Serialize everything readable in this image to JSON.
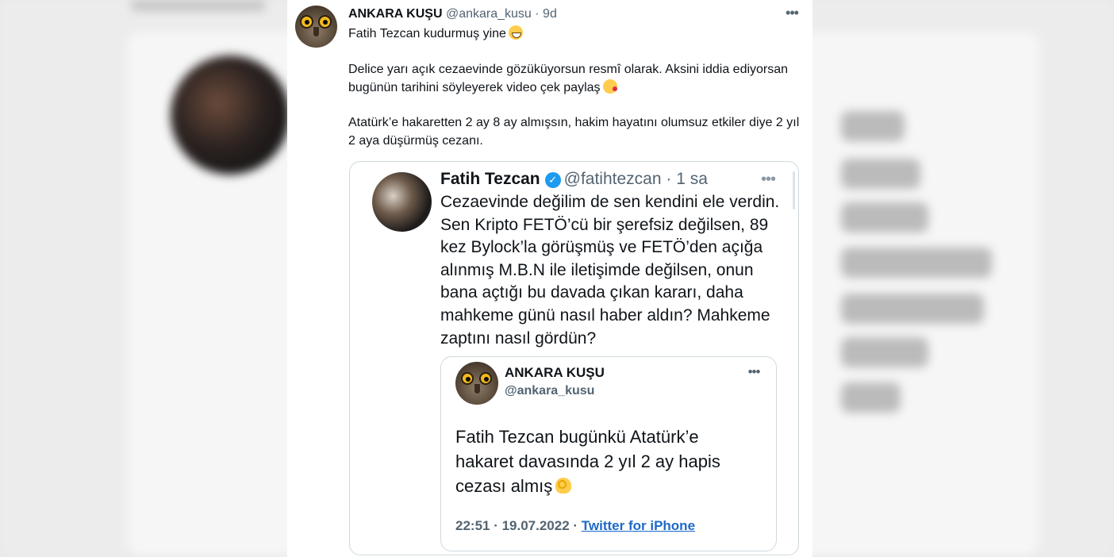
{
  "tweet": {
    "name": "ANKARA KUŞU",
    "handle": "@ankara_kusu",
    "separator": " · ",
    "time": "9d",
    "more_icon": "more-horizontal-icon",
    "line1": "Fatih Tezcan kudurmuş yine",
    "para2": "Delice yarı açık cezaevinde gözüküyorsun resmî olarak. Aksini iddia ediyorsan bugünün tarihini söyleyerek video çek paylaş",
    "para3": "Atatürk’e hakaretten 2 ay 8 ay almışsın, hakim hayatını olumsuz etkiler diye 2 yıl 2 aya düşürmüş cezanı."
  },
  "quote": {
    "name": "Fatih Tezcan",
    "handle": "@fatihtezcan",
    "separator": " · ",
    "time": "1 sa",
    "text": "Cezaevinde değilim de sen kendini ele verdin. Sen Kripto FETÖ’cü bir şerefsiz değilsen, 89 kez Bylock’la görüşmüş ve FETÖ’den açığa alınmış M.B.N ile iletişimde değilsen, onun bana açtığı bu davada çıkan kararı, daha mahkeme günü nasıl haber aldın? Mahkeme zaptını nasıl gördün?"
  },
  "inner": {
    "name": "ANKARA KUŞU",
    "handle": "@ankara_kusu",
    "text": "Fatih Tezcan bugünkü Atatürk’e hakaret davasında 2 yıl 2 ay hapis cezası almış",
    "time": "22:51 · 19.07.2022 · ",
    "source": "Twitter for iPhone"
  },
  "colors": {
    "text": "#0f1419",
    "secondary": "#536471",
    "border": "#cfd9de",
    "verified": "#1d9bf0",
    "link": "#1d68c9"
  }
}
